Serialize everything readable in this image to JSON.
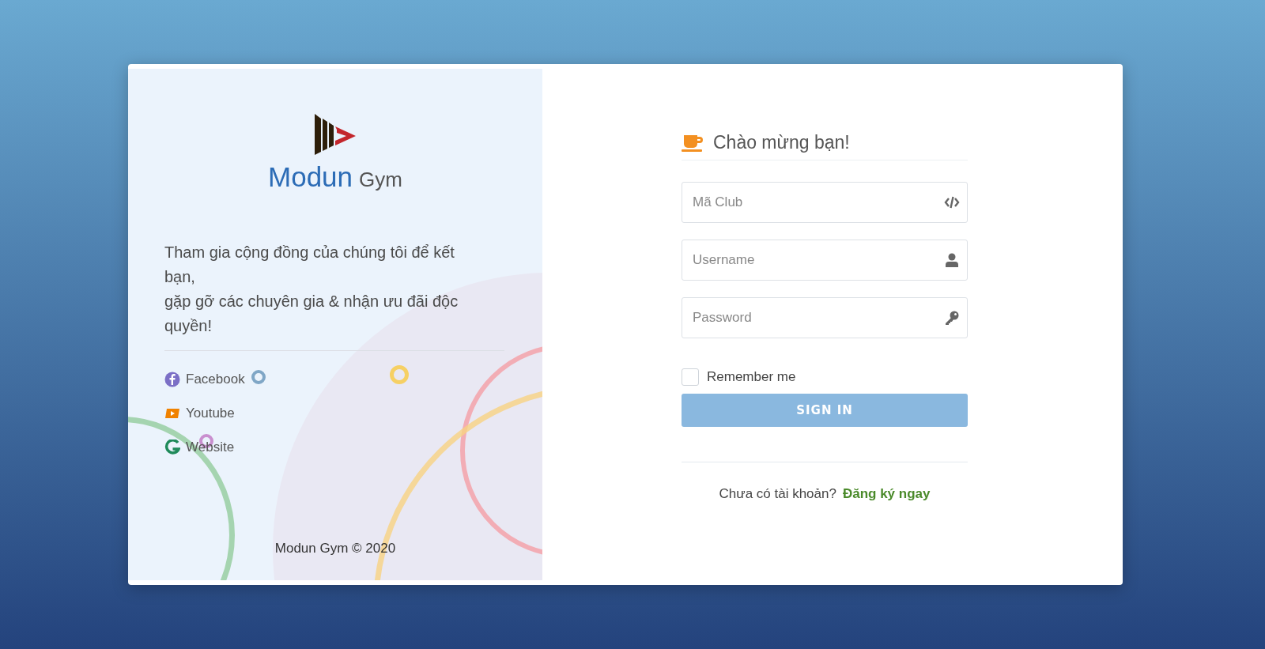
{
  "brand": {
    "name": "Modun",
    "suffix": "Gym"
  },
  "intro": [
    "Tham gia cộng đồng của chúng tôi để kết bạn,",
    "gặp gỡ các chuyên gia & nhận ưu đãi độc quyền!"
  ],
  "links": [
    {
      "kind": "facebook",
      "label": "Facebook"
    },
    {
      "kind": "youtube",
      "label": "Youtube"
    },
    {
      "kind": "website",
      "label": "Website"
    }
  ],
  "footer": "Modun Gym © 2020",
  "form": {
    "title": "Chào mừng bạn!",
    "fields": [
      {
        "kind": "code",
        "placeholder": "Mã Club"
      },
      {
        "kind": "user",
        "placeholder": "Username"
      },
      {
        "kind": "password",
        "placeholder": "Password"
      }
    ],
    "remember": {
      "label": "Remember me",
      "checked": false
    },
    "submit": "SIGN IN",
    "signup_prompt": "Chưa có tài khoản?",
    "signup_link": "Đăng ký ngay"
  }
}
